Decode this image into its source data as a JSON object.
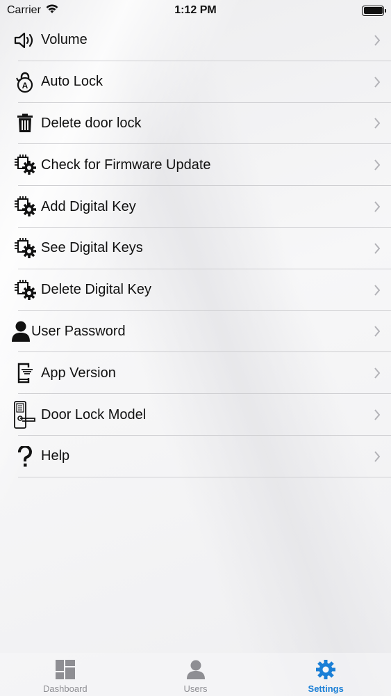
{
  "status_bar": {
    "carrier": "Carrier",
    "time": "1:12 PM"
  },
  "settings": {
    "items": [
      {
        "label": "Volume",
        "icon": "speaker-icon"
      },
      {
        "label": "Auto Lock",
        "icon": "auto-lock-icon"
      },
      {
        "label": "Delete door lock",
        "icon": "trash-icon"
      },
      {
        "label": "Check for Firmware Update",
        "icon": "chip-gear-icon"
      },
      {
        "label": "Add Digital Key",
        "icon": "chip-gear-icon"
      },
      {
        "label": "See Digital Keys",
        "icon": "chip-gear-icon"
      },
      {
        "label": "Delete Digital Key",
        "icon": "chip-gear-icon"
      },
      {
        "label": "User Password",
        "icon": "user-icon"
      },
      {
        "label": "App Version",
        "icon": "phone-icon"
      },
      {
        "label": "Door Lock Model",
        "icon": "door-lock-icon"
      },
      {
        "label": "Help",
        "icon": "question-icon"
      }
    ]
  },
  "tabbar": {
    "tabs": [
      {
        "label": "Dashboard",
        "icon": "dashboard-icon"
      },
      {
        "label": "Users",
        "icon": "users-icon"
      },
      {
        "label": "Settings",
        "icon": "gear-icon"
      }
    ],
    "active_color": "#1a7fd6",
    "inactive_color": "#8e8e93"
  }
}
